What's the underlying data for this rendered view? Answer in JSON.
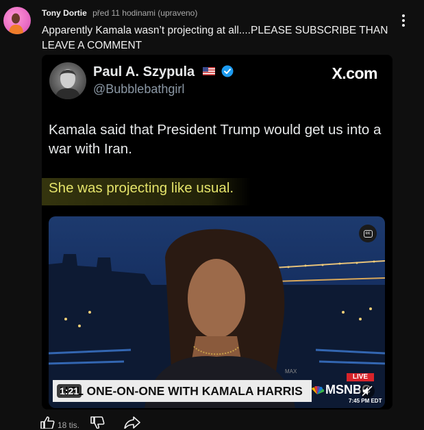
{
  "comment": {
    "author": "Tony Dortie",
    "time": "před 11 hodinami (upraveno)",
    "text": "Apparently Kamala wasn’t projecting at all....PLEASE SUBSCRIBE THAN LEAVE A COMMENT",
    "like_count": "18 tis."
  },
  "tweet": {
    "name": "Paul A. Szypula",
    "handle": "@Bubblebathgirl",
    "site_logo": "X.com",
    "text1": "Kamala said that President Trump would get us into a war with Iran.",
    "text2": "She was projecting like usual."
  },
  "video": {
    "chyron": "HEL ONE-ON-ONE WITH KAMALA HARRIS",
    "duration": "1:21",
    "live_badge": "LIVE",
    "network": "MSNBC",
    "clock": "7:45 PM EDT",
    "watermark": "MAX"
  },
  "icons": {
    "menu": "more-vert-icon",
    "like": "thumb-up-icon",
    "dislike": "thumb-down-icon",
    "share": "share-icon",
    "cc": "closed-captions-icon",
    "mute": "mute-icon",
    "verified": "verified-badge-icon",
    "flag": "us-flag-icon"
  },
  "colors": {
    "background": "#0f0f0f",
    "highlight_text": "#e4e36a",
    "live_red": "#d8232a",
    "verified_blue": "#1d9bf0"
  }
}
